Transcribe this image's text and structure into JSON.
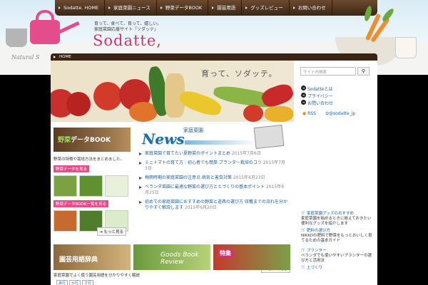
{
  "nav": {
    "items": [
      "Sodatte. HOME",
      "家庭菜園ニュース",
      "野菜データBOOK",
      "園芸用語",
      "グッズレビュー",
      "お問い合わせ"
    ]
  },
  "header": {
    "tagline_line1": "育って、食べて、育って、嬉しい。",
    "tagline_line2": "家庭菜園応援サイト「ソダッテ」",
    "logo": "Sodatte,",
    "natural": "Natural S"
  },
  "breadcrumb": {
    "home": "HOME"
  },
  "hero": {
    "text": "育って、ソダッテ。"
  },
  "book": {
    "banner_kanji": "野菜",
    "banner_rest": "データBOOK",
    "description": "野菜の特徴や栽培方法をまとめました。",
    "tag1": "野菜データを見る",
    "tag2": "野菜データBOOK一覧を見る",
    "more": "もっと見る"
  },
  "news": {
    "kanji": "家庭菜園",
    "title": "News",
    "items": [
      {
        "title": "家庭菜園で育てたい夏野菜のポイントまとめ",
        "date": "2015年7月6日"
      },
      {
        "title": "ミニトマトの育て方｜初心者でも簡単 プランター栽培のコツ",
        "date": "2015年7月3日"
      },
      {
        "title": "梅雨時期の家庭菜園の注意点 病気と害虫対策",
        "date": "2015年6月23日"
      },
      {
        "title": "ベランダ菜園に最適な野菜の選び方と土づくりの基本ポイント",
        "date": "2015年6月25日"
      },
      {
        "title": "初めての家庭菜園におすすめの野菜と道具の選び方 収穫までの流れを分かりやすく解説します",
        "date": "2015年6月20日"
      }
    ],
    "more": "もっと見る"
  },
  "cards": [
    {
      "label": "園芸用語辞典",
      "caption": "家庭菜園でよく使う園芸用語を分かりやすく解説",
      "tags": [
        "あ行",
        "か行",
        "さ行"
      ]
    },
    {
      "label": "Goods Book Review",
      "caption": "",
      "tags": []
    },
    {
      "label": "特集",
      "caption": "",
      "tags": []
    }
  ],
  "sidebar": {
    "search_placeholder": "サイト内検索",
    "search_icon": "search-icon",
    "links": [
      "Sodatteとは",
      "プライバシー",
      "お問い合わせ"
    ],
    "rss": "RSS",
    "twitter": "@sodatte_jp",
    "items": [
      {
        "cat": "家庭菜園グッズのおすすめ",
        "body": "家庭菜園を始めるときに揃えておきたい便利なグッズを紹介します"
      },
      {
        "cat": "肥料の選び方",
        "body": "NIKKOの肥料で野菜をもっとおいしく育てるための基本ガイド"
      },
      {
        "cat": "プランター",
        "body": "ベランダでも使いやすいプランターの選び方と活用法"
      },
      {
        "cat": "土づくり",
        "body": ""
      }
    ]
  },
  "colors": {
    "brand": "#d0346a",
    "nav": "#4a3220",
    "link": "#1b5fa0",
    "tag": "#e64c8a"
  }
}
